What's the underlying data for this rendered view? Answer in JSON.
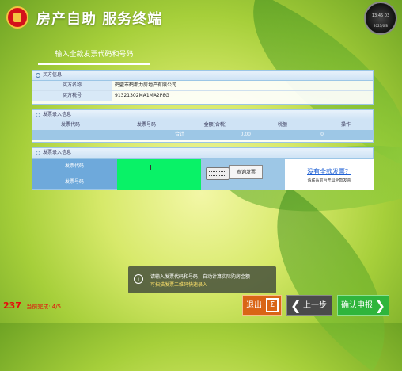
{
  "header": {
    "title": "房产自助 服务终端",
    "clock_time": "13:45 03",
    "clock_date": "2023/6/8"
  },
  "tab": {
    "label": "输入全款发票代码和号码"
  },
  "buyer": {
    "section_title": "买方信息",
    "name_label": "买方名称",
    "name_value": "鹤壁市鹤都力房地产有限公司",
    "tax_label": "买方税号",
    "tax_value": "91321302MA1MA2P8G"
  },
  "invoices": {
    "section_title": "发票录入信息",
    "columns": [
      "发票代码",
      "发票号码",
      "金额(含税)",
      "税额",
      "操作"
    ],
    "total_label": "合计",
    "total_amount": "0.00",
    "total_tax": "0"
  },
  "entry": {
    "section_title": "发票录入信息",
    "code_label": "发票代码",
    "number_label": "发票号码",
    "query_button": "查询发票",
    "no_full_link": "没有全款发票？",
    "no_full_hint": "请联系前台开具全款发票"
  },
  "message": {
    "line1": "请输入发票代码和号码，自动计算实际购房金额",
    "line2": "可扫描发票二维码快速录入"
  },
  "status": {
    "countdown": "237",
    "progress": "当前完成: 4/5"
  },
  "buttons": {
    "exit": "退出",
    "prev": "上一步",
    "submit": "确认申报"
  }
}
